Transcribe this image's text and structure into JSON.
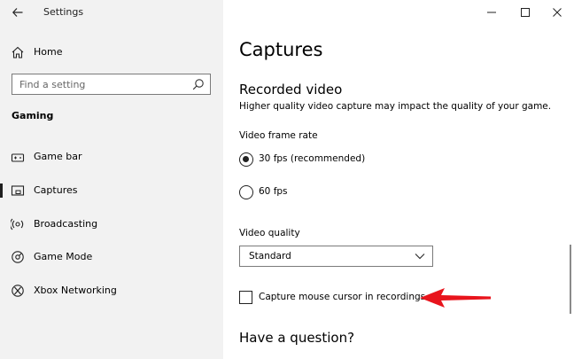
{
  "window": {
    "title": "Settings"
  },
  "sidebar": {
    "home_label": "Home",
    "search_placeholder": "Find a setting",
    "section": "Gaming",
    "items": [
      {
        "label": "Game bar",
        "icon": "game-bar-icon"
      },
      {
        "label": "Captures",
        "icon": "captures-icon",
        "active": true
      },
      {
        "label": "Broadcasting",
        "icon": "broadcasting-icon"
      },
      {
        "label": "Game Mode",
        "icon": "game-mode-icon"
      },
      {
        "label": "Xbox Networking",
        "icon": "xbox-icon"
      }
    ]
  },
  "main": {
    "title": "Captures",
    "recorded_video": {
      "heading": "Recorded video",
      "description": "Higher quality video capture may impact the quality of your game."
    },
    "frame_rate": {
      "label": "Video frame rate",
      "options": [
        {
          "label": "30 fps (recommended)",
          "selected": true
        },
        {
          "label": "60 fps",
          "selected": false
        }
      ]
    },
    "video_quality": {
      "label": "Video quality",
      "selected": "Standard"
    },
    "capture_cursor": {
      "label": "Capture mouse cursor in recordings",
      "checked": false
    },
    "question_heading": "Have a question?"
  },
  "colors": {
    "sidebar_bg": "#f2f2f2",
    "annotation_arrow": "#e8141c"
  }
}
